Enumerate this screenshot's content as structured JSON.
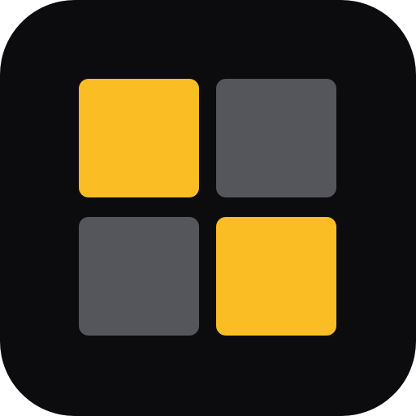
{
  "icon": {
    "name": "grid-app-icon",
    "background_color": "#0c0c0e",
    "tiles": [
      {
        "position": "top-left",
        "color": "#fbbd24"
      },
      {
        "position": "top-right",
        "color": "#55565b"
      },
      {
        "position": "bottom-left",
        "color": "#55565b"
      },
      {
        "position": "bottom-right",
        "color": "#fbbd24"
      }
    ]
  }
}
